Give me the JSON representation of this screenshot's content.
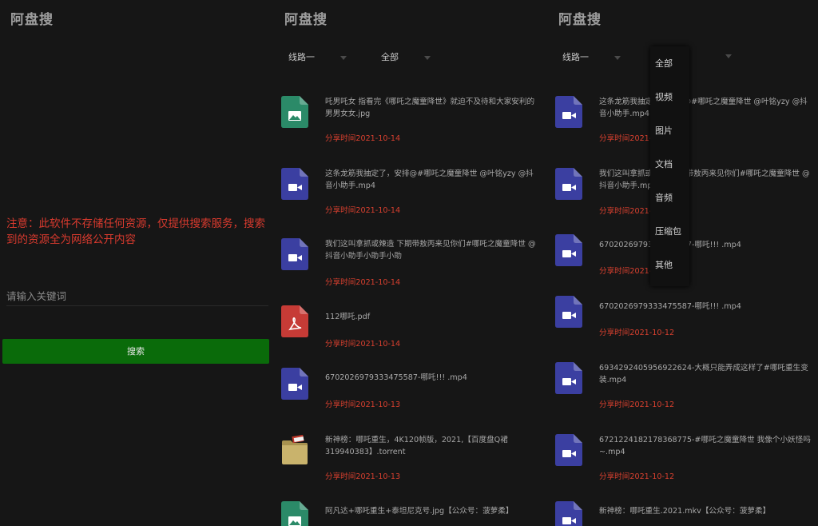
{
  "app_title": "阿盘搜",
  "notice": "注意：此软件不存储任何资源，仅提供搜索服务，搜索到的资源全为网络公开内容",
  "search": {
    "placeholder": "请输入关键词",
    "button": "搜索"
  },
  "route_select": "线路一",
  "type_select": "全部",
  "type_options": [
    "全部",
    "视频",
    "图片",
    "文档",
    "音频",
    "压缩包",
    "其他"
  ],
  "colors": {
    "time": "#d9402f",
    "notice": "#d93a2e",
    "button": "#0a6b0a",
    "video": "#3b3fa1",
    "image": "#2b8a68",
    "pdf": "#c63b36",
    "torrent": "#c9b36c"
  },
  "list_a": [
    {
      "icon": "image-file-icon",
      "name": "吒男吒女 指看完《哪吒之魔童降世》就迫不及待和大家安利的男男女女.jpg",
      "time": "分享时间2021-10-14"
    },
    {
      "icon": "video-file-icon",
      "name": "这条龙筋我抽定了，安排@#哪吒之魔童降世 @叶铭yzy @抖音小助手.mp4",
      "time": "分享时间2021-10-14"
    },
    {
      "icon": "video-file-icon",
      "name": "我们这叫拿抓或辣造 下期带敖丙来见你们#哪吒之魔童降世 @抖音小助手小助手小助",
      "time": "分享时间2021-10-14"
    },
    {
      "icon": "pdf-file-icon",
      "name": "112哪吒.pdf",
      "time": "分享时间2021-10-14"
    },
    {
      "icon": "video-file-icon",
      "name": "6702026979333475587-哪吒!!! .mp4",
      "time": "分享时间2021-10-13"
    },
    {
      "icon": "torrent-file-icon",
      "name": "新神榜：哪吒重生，4K120帧版，2021,【百度盘Q裙319940383】.torrent",
      "time": "分享时间2021-10-13"
    },
    {
      "icon": "image-file-icon",
      "name": "阿凡达+哪吒重生+泰坦尼克号.jpg【公众号：菠萝柔】",
      "time": ""
    }
  ],
  "list_b": [
    {
      "icon": "video-file-icon",
      "name": "这条龙筋我抽定了，安排@#哪吒之魔童降世 @叶铭yzy @抖音小助手.mp4",
      "time": "分享时间2021-10-14"
    },
    {
      "icon": "video-file-icon",
      "name": "我们这叫拿抓或辣造 下期带敖丙来见你们#哪吒之魔童降世 @抖音小助手.mp4",
      "time": "分享时间2021-10-14"
    },
    {
      "icon": "video-file-icon",
      "name": "6702026979333475587-哪吒!!! .mp4",
      "time": "分享时间2021-10-13"
    },
    {
      "icon": "video-file-icon",
      "name": "6702026979333475587-哪吒!!! .mp4",
      "time": "分享时间2021-10-12"
    },
    {
      "icon": "video-file-icon",
      "name": "6934292405956922624-大概只能弄成这样了#哪吒重生变装.mp4",
      "time": "分享时间2021-10-12"
    },
    {
      "icon": "video-file-icon",
      "name": "6721224182178368775-#哪吒之魔童降世 我像个小妖怪吗~.mp4",
      "time": "分享时间2021-10-12"
    },
    {
      "icon": "video-file-icon",
      "name": "新神榜：哪吒重生.2021.mkv【公众号：菠萝柔】",
      "time": ""
    }
  ]
}
